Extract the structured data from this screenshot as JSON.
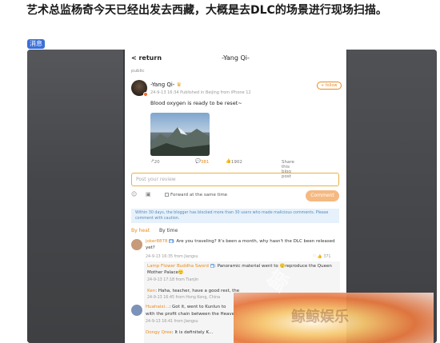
{
  "headline": "艺术总监杨奇今天已经出发去西藏，大概是去DLC的场景进行现场扫描。",
  "tag": "消息",
  "nav": {
    "back": "< return",
    "title": "-Yang Qi-"
  },
  "post": {
    "visibility": "public",
    "author": "-Yang Qi-",
    "crown": "♛",
    "meta": "24-9-13 16:34 Published in Beijing from iPhone 12",
    "follow": "+ follow",
    "text": "Blood oxygen is ready to be reset~",
    "stats": {
      "forward": "20",
      "comments": "381",
      "likes": "1902",
      "share": "Share this blog post"
    }
  },
  "review": {
    "placeholder": "Post your review",
    "forward_label": "Forward at the same time",
    "comment_button": "Comment"
  },
  "notice": "Within 30 days, the blogger has blocked more than 30 users who made malicious comments. Please comment with caution.",
  "sort": {
    "hot": "By heat",
    "time": "By time"
  },
  "comments": [
    {
      "user": "joker8878",
      "text": "Are you traveling? It's been a month, why hasn't the DLC been released yet?",
      "meta": "24-9-13 16:35 from Jiangsu",
      "likes": "371"
    },
    {
      "user": "Lamp Flower Buddha Sword",
      "text": "Panoramic material went to 🙂reproduce the Queen Mother Palace🙂",
      "meta": "24-9-13 17:18 from Tianjin"
    },
    {
      "user": "Ken",
      "text": "Haha, teacher, have a good rest, the",
      "meta": "24-9-13 16:45 from Hong Kong, China"
    },
    {
      "user": "Huahaixi...",
      "text": "Got it, went to Kunlun to",
      "text2": "with the profit chain between the Heaven",
      "meta": "24-9-13 16:41 from Jiangsu"
    },
    {
      "user": "Dongy Qree",
      "text": "It is definitely K..."
    }
  ],
  "watermark": "鲸鲸娱乐"
}
